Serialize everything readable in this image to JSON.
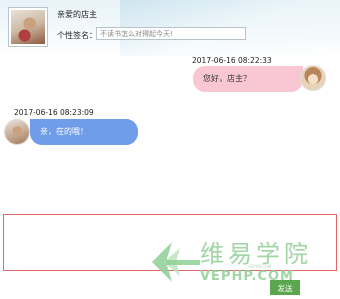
{
  "header": {
    "shop_name": "亲爱的店主",
    "signature_label": "个性签名：",
    "signature_value": "不读书怎么对得起今天!"
  },
  "messages": [
    {
      "timestamp": "2017-06-16 08:22:33",
      "text": "您好，店主？",
      "side": "right",
      "bubble_color": "#f9c6d3"
    },
    {
      "timestamp": "2017-06-16 08:23:09",
      "text": "亲，在的哦！",
      "side": "left",
      "bubble_color": "#6f9de8"
    }
  ],
  "composer": {
    "input_value": "",
    "border_color": "#e06a6a",
    "send_label": "发送",
    "send_color": "#5aa74d"
  },
  "watermark": {
    "cn": "维易学院",
    "en": "VEPHP.COM",
    "sub": "VEPHP.COM",
    "icon": "arrow-logo-icon"
  }
}
